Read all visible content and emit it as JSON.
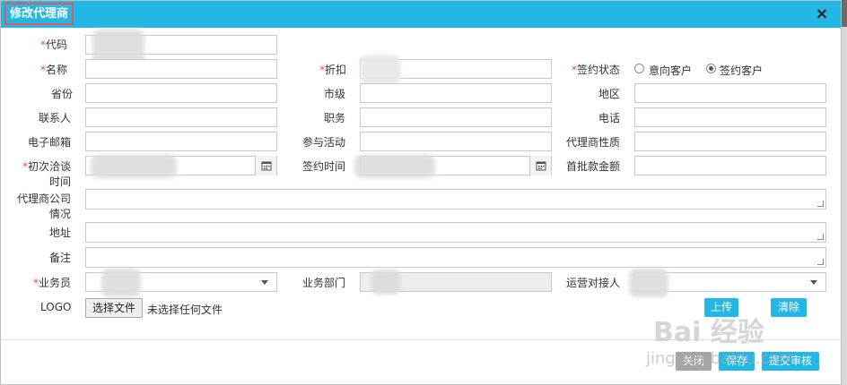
{
  "dialog": {
    "title": "修改代理商",
    "close": "×"
  },
  "fields": {
    "code": "代码",
    "name": "名称",
    "discount": "折扣",
    "sign_status": "签约状态",
    "sign_options": [
      "意向客户",
      "签约客户"
    ],
    "sign_selected": "签约客户",
    "province": "省份",
    "city": "市级",
    "district": "地区",
    "contact": "联系人",
    "position": "职务",
    "phone": "电话",
    "email": "电子邮箱",
    "activity": "参与活动",
    "agent_nature": "代理商性质",
    "first_talk_1": "初次洽谈",
    "first_talk_2": "时间",
    "sign_time": "签约时间",
    "first_payment": "首批款金额",
    "company_info_1": "代理商公司",
    "company_info_2": "情况",
    "address": "地址",
    "remark": "备注",
    "salesman": "业务员",
    "dept": "业务部门",
    "ops_contact": "运营对接人",
    "logo": "LOGO",
    "file_button": "选择文件",
    "file_status": "未选择任何文件",
    "required_mark": "*"
  },
  "buttons": {
    "clear": "清除",
    "upload": "上传",
    "cancel": "关闭",
    "save": "保存",
    "submit": "提交审核"
  },
  "watermark": {
    "brand": "Bai 经验",
    "url": "jingyan.baidu.com"
  },
  "colors": {
    "title_bar": "#23b7e5",
    "required": "#e84b4b",
    "title_outline": "#e05a5a"
  }
}
